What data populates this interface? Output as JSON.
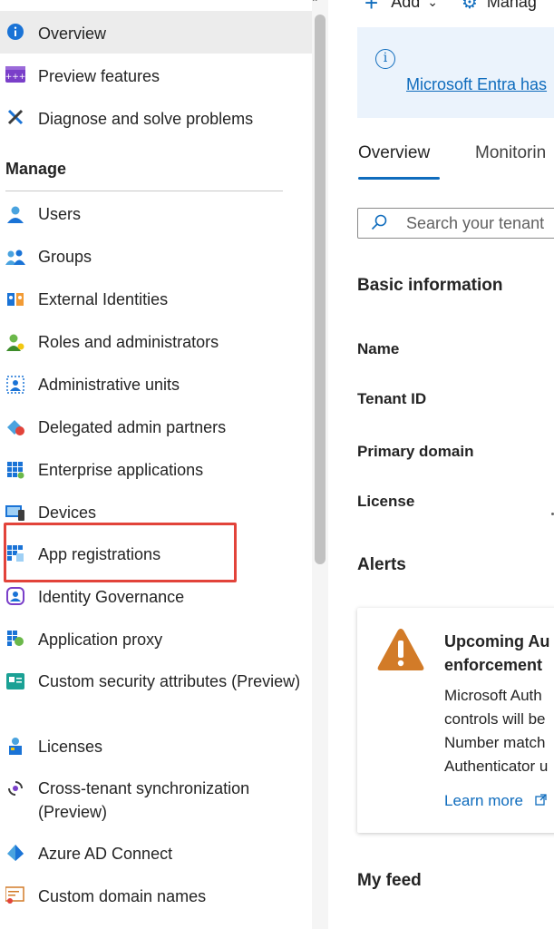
{
  "sidebar": {
    "top_items": [
      {
        "label": "Overview",
        "icon": "info-icon"
      },
      {
        "label": "Preview features",
        "icon": "preview-features-icon"
      },
      {
        "label": "Diagnose and solve problems",
        "icon": "wrench-icon"
      }
    ],
    "manage_header": "Manage",
    "manage_items": [
      {
        "label": "Users",
        "icon": "user-icon"
      },
      {
        "label": "Groups",
        "icon": "groups-icon"
      },
      {
        "label": "External Identities",
        "icon": "external-identities-icon"
      },
      {
        "label": "Roles and administrators",
        "icon": "roles-icon"
      },
      {
        "label": "Administrative units",
        "icon": "admin-units-icon"
      },
      {
        "label": "Delegated admin partners",
        "icon": "delegated-admin-icon"
      },
      {
        "label": "Enterprise applications",
        "icon": "enterprise-apps-icon"
      },
      {
        "label": "Devices",
        "icon": "devices-icon"
      },
      {
        "label": "App registrations",
        "icon": "app-registrations-icon"
      },
      {
        "label": "Identity Governance",
        "icon": "identity-governance-icon"
      },
      {
        "label": "Application proxy",
        "icon": "app-proxy-icon"
      },
      {
        "label": "Custom security attributes (Preview)",
        "icon": "custom-security-icon"
      },
      {
        "label": "Licenses",
        "icon": "licenses-icon"
      },
      {
        "label": "Cross-tenant synchronization (Preview)",
        "icon": "cross-tenant-sync-icon"
      },
      {
        "label": "Azure AD Connect",
        "icon": "azure-ad-connect-icon"
      },
      {
        "label": "Custom domain names",
        "icon": "custom-domain-icon"
      }
    ]
  },
  "toolbar": {
    "add_label": "Add",
    "manage_label": "Manag"
  },
  "banner": {
    "link_text": "Microsoft Entra has"
  },
  "tabs": {
    "overview": "Overview",
    "monitoring": "Monitorin"
  },
  "search": {
    "placeholder": "Search your tenant"
  },
  "basic_info": {
    "heading": "Basic information",
    "name_label": "Name",
    "tenant_id_label": "Tenant ID",
    "primary_domain_label": "Primary domain",
    "license_label": "License"
  },
  "alerts": {
    "heading": "Alerts",
    "card": {
      "title_line1": "Upcoming Au",
      "title_line2": "enforcement",
      "body_line1": "Microsoft Auth",
      "body_line2": "controls will be",
      "body_line3": "Number match",
      "body_line4": "Authenticator u",
      "link": "Learn more"
    }
  },
  "feed": {
    "heading": "My feed"
  },
  "colors": {
    "accent": "#0f6cbd",
    "highlight_box": "#e2433a",
    "warning": "#d27b28"
  }
}
